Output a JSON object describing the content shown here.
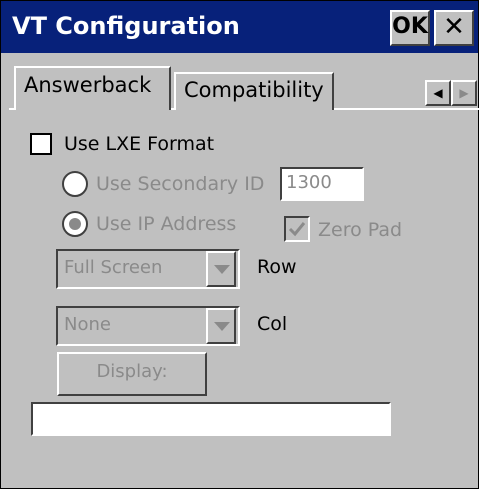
{
  "window": {
    "title": "VT Configuration",
    "ok_label": "OK",
    "close_label": "✕"
  },
  "tabs": [
    {
      "label": "Answerback",
      "selected": true
    },
    {
      "label": "Compatibility",
      "selected": false
    }
  ],
  "tab_scroll": {
    "left": "◀",
    "right": "▶"
  },
  "answerback": {
    "use_lxe_format": {
      "label": "Use LXE Format",
      "checked": false
    },
    "use_secondary_id": {
      "label": "Use Secondary ID",
      "selected": false,
      "enabled": false
    },
    "secondary_id_value": "1300",
    "use_ip_address": {
      "label": "Use IP Address",
      "selected": true,
      "enabled": false
    },
    "zero_pad": {
      "label": "Zero Pad",
      "checked": true,
      "enabled": false
    },
    "row": {
      "label": "Row",
      "value": "Full Screen"
    },
    "col": {
      "label": "Col",
      "value": "None"
    },
    "display_button": "Display:",
    "display_output": ""
  }
}
